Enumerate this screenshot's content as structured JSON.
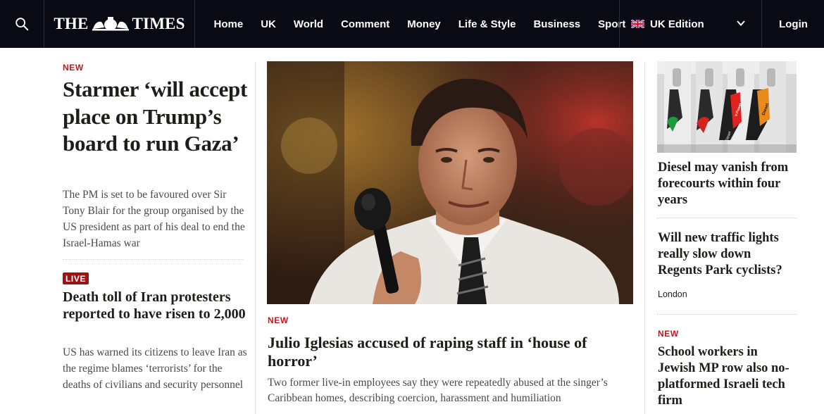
{
  "nav": {
    "masthead": "THE TIMES",
    "masthead_left": "THE",
    "masthead_right": "TIMES",
    "links": [
      "Home",
      "UK",
      "World",
      "Comment",
      "Money",
      "Life & Style",
      "Business",
      "Sport"
    ],
    "edition": "UK Edition",
    "login": "Login",
    "icons": {
      "search": "search-icon",
      "edition_flag": "uk-flag-icon",
      "edition_toggle": "chevron-down-icon"
    }
  },
  "lead": {
    "tag": "NEW",
    "headline": "Starmer ‘will accept place on Trump’s board to run Gaza’",
    "standfirst": "The PM is set to be favoured over Sir Tony Blair for the group organised by the US president as part of his deal to end the Israel-Hamas war"
  },
  "live_story": {
    "tag": "LIVE",
    "headline": "Death toll of Iran protesters reported to have risen to 2,000",
    "standfirst": "US has warned its citizens to leave Iran as the regime blames ‘terrorists’ for the deaths of civilians and security personnel"
  },
  "centre": {
    "tag": "NEW",
    "headline": "Julio Iglesias accused of raping staff in ‘house of horror’",
    "standfirst": "Two former live-in employees say they were repeatedly abused at the singer’s Caribbean homes, describing coercion, harassment and humiliation"
  },
  "side": [
    {
      "headline": "Diesel may vanish from forecourts within four years"
    },
    {
      "headline": "Will new traffic lights really slow down Regents Park cyclists?",
      "category": "London"
    },
    {
      "tag": "NEW",
      "headline": "School workers in Jewish MP row also no-platformed Israeli tech firm"
    }
  ],
  "pump_labels": [
    "Diesel",
    "V-Power",
    "Diesel"
  ],
  "colors": {
    "nav_bg": "#0a0a14",
    "accent_red": "#c4161c",
    "live_red": "#9e1212"
  }
}
